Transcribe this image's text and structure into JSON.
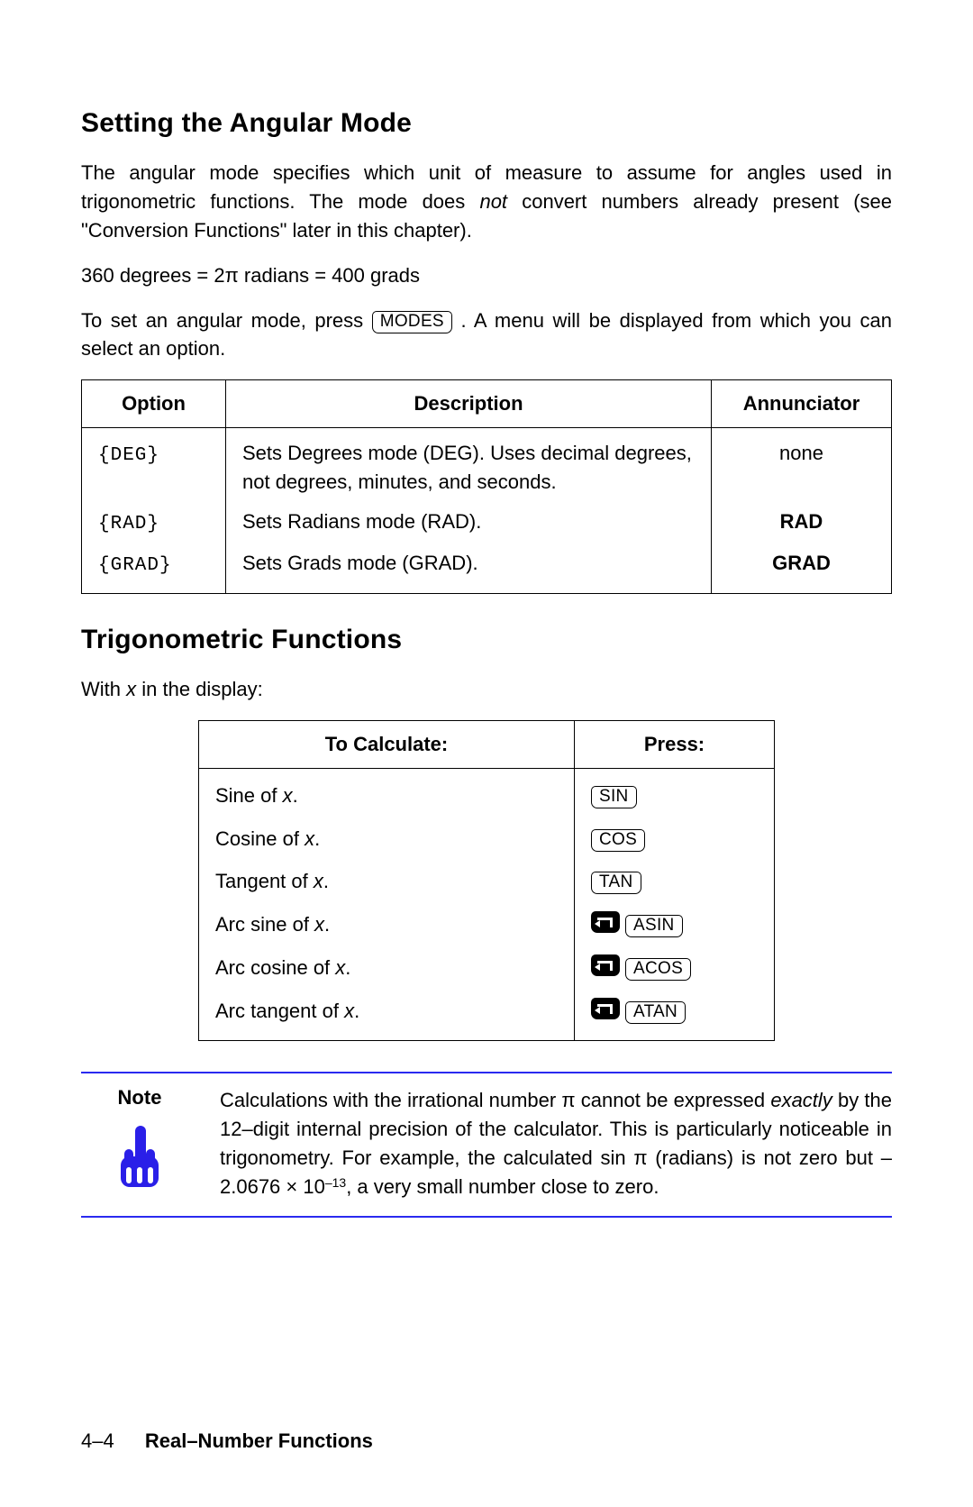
{
  "heading1": "Setting the Angular Mode",
  "para1a": "The angular mode specifies which unit of measure to assume for angles used in trigonometric functions. The mode does ",
  "para1_ital": "not",
  "para1b": " convert numbers already present (see \"Conversion Functions\" later in this chapter).",
  "para2": "360 degrees = 2π radians = 400 grads",
  "para3a": "To set an angular mode, press ",
  "key_modes": "MODES",
  "para3b": " . A menu will be displayed from which you can select an option.",
  "t1": {
    "headers": {
      "opt": "Option",
      "desc": "Description",
      "ann": "Annunciator"
    },
    "rows": [
      {
        "opt": "{DEG}",
        "desc": "Sets Degrees mode (DEG). Uses decimal degrees, not degrees, minutes, and seconds.",
        "ann": "none",
        "ann_bold": false
      },
      {
        "opt": "{RAD}",
        "desc": "Sets Radians mode (RAD).",
        "ann": "RAD",
        "ann_bold": true
      },
      {
        "opt": "{GRAD}",
        "desc": "Sets Grads mode (GRAD).",
        "ann": "GRAD",
        "ann_bold": true
      }
    ]
  },
  "heading2": "Trigonometric Functions",
  "with_x_a": "With ",
  "with_x_var": "x",
  "with_x_b": " in the display:",
  "t2": {
    "headers": {
      "calc": "To Calculate:",
      "press": "Press:"
    },
    "rows": [
      {
        "label_a": "Sine of ",
        "var": "x",
        "label_b": ".",
        "shift": false,
        "key": "SIN"
      },
      {
        "label_a": "Cosine of ",
        "var": "x",
        "label_b": ".",
        "shift": false,
        "key": "COS"
      },
      {
        "label_a": "Tangent of ",
        "var": "x",
        "label_b": ".",
        "shift": false,
        "key": "TAN"
      },
      {
        "label_a": "Arc sine of ",
        "var": "x",
        "label_b": ".",
        "shift": true,
        "key": "ASIN"
      },
      {
        "label_a": "Arc cosine of ",
        "var": "x",
        "label_b": ".",
        "shift": true,
        "key": "ACOS"
      },
      {
        "label_a": "Arc tangent of ",
        "var": "x",
        "label_b": ".",
        "shift": true,
        "key": "ATAN"
      }
    ]
  },
  "note": {
    "label": "Note",
    "a": "Calculations with the irrational number π cannot be expressed ",
    "ital": "exactly",
    "b": " by the 12–digit internal precision of the calculator. This is particularly noticeable in trigonometry. For example, the calculated sin π (radians) is not zero but –2.0676 × 10",
    "sup": "–13",
    "c": ", a very small number close to zero."
  },
  "footer": {
    "page": "4–4",
    "chapter": "Real–Number Functions"
  }
}
